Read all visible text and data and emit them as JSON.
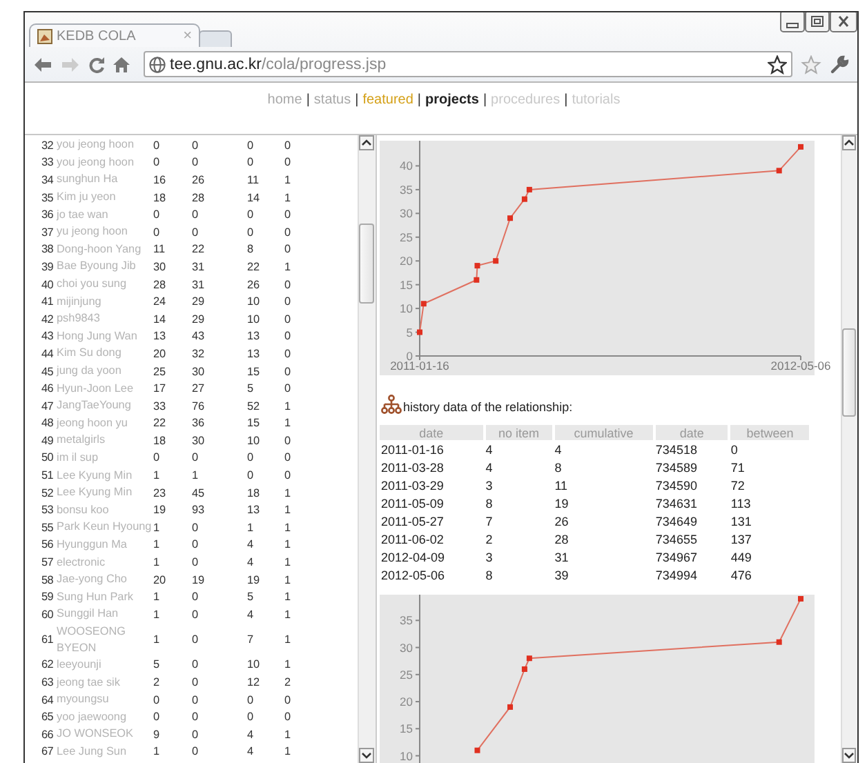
{
  "window": {
    "tab": {
      "title": "KEDB COLA",
      "close": "×",
      "selected": true
    },
    "address": {
      "host": "tee.gnu.ac.kr",
      "path": "/cola/progress.jsp"
    }
  },
  "nav": [
    {
      "label": "home",
      "kind": "muted",
      "separator": "|"
    },
    {
      "label": "status",
      "kind": "muted",
      "separator": "|"
    },
    {
      "label": "featured",
      "kind": "highlight",
      "separator": "|"
    },
    {
      "label": "projects",
      "kind": "current",
      "separator": "|"
    },
    {
      "label": "procedures",
      "kind": "faint",
      "separator": "|"
    },
    {
      "label": "tutorials",
      "kind": "faint"
    }
  ],
  "members": [
    {
      "no": "32",
      "name": "you jeong hoon",
      "values": [
        "0",
        "0",
        "0",
        "0"
      ]
    },
    {
      "no": "33",
      "name": "you jeong hoon",
      "values": [
        "0",
        "0",
        "0",
        "0"
      ]
    },
    {
      "no": "34",
      "name": "sunghun Ha",
      "values": [
        "16",
        "26",
        "11",
        "1"
      ]
    },
    {
      "no": "35",
      "name": "Kim ju yeon",
      "values": [
        "18",
        "28",
        "14",
        "1"
      ]
    },
    {
      "no": "36",
      "name": "jo tae wan",
      "values": [
        "0",
        "0",
        "0",
        "0"
      ]
    },
    {
      "no": "37",
      "name": "yu jeong hoon",
      "values": [
        "0",
        "0",
        "0",
        "0"
      ]
    },
    {
      "no": "38",
      "name": "Dong-hoon Yang",
      "values": [
        "11",
        "22",
        "8",
        "0"
      ]
    },
    {
      "no": "39",
      "name": "Bae Byoung Jib",
      "values": [
        "30",
        "31",
        "22",
        "1"
      ]
    },
    {
      "no": "40",
      "name": "choi you sung",
      "values": [
        "28",
        "31",
        "26",
        "0"
      ]
    },
    {
      "no": "41",
      "name": "mijinjung",
      "values": [
        "24",
        "29",
        "10",
        "0"
      ]
    },
    {
      "no": "42",
      "name": "psh9843",
      "values": [
        "14",
        "29",
        "10",
        "0"
      ]
    },
    {
      "no": "43",
      "name": "Hong Jung Wan",
      "values": [
        "13",
        "43",
        "13",
        "0"
      ]
    },
    {
      "no": "44",
      "name": "Kim Su dong",
      "values": [
        "20",
        "32",
        "13",
        "0"
      ]
    },
    {
      "no": "45",
      "name": "jung da yoon",
      "values": [
        "25",
        "30",
        "15",
        "0"
      ]
    },
    {
      "no": "46",
      "name": "Hyun-Joon Lee",
      "values": [
        "17",
        "27",
        "5",
        "0"
      ]
    },
    {
      "no": "47",
      "name": "JangTaeYoung",
      "values": [
        "33",
        "76",
        "52",
        "1"
      ]
    },
    {
      "no": "48",
      "name": "jeong hoon yu",
      "values": [
        "22",
        "36",
        "15",
        "1"
      ]
    },
    {
      "no": "49",
      "name": "metalgirls",
      "values": [
        "18",
        "30",
        "10",
        "0"
      ]
    },
    {
      "no": "50",
      "name": "im il sup",
      "values": [
        "0",
        "0",
        "0",
        "0"
      ]
    },
    {
      "no": "51",
      "name": "Lee Kyung Min",
      "values": [
        "1",
        "1",
        "0",
        "0"
      ]
    },
    {
      "no": "52",
      "name": "Lee Kyung Min",
      "values": [
        "23",
        "45",
        "18",
        "1"
      ]
    },
    {
      "no": "53",
      "name": "bonsu koo",
      "values": [
        "19",
        "93",
        "13",
        "1"
      ]
    },
    {
      "no": "55",
      "name": "Park Keun Hyoung",
      "values": [
        "1",
        "0",
        "1",
        "1"
      ]
    },
    {
      "no": "56",
      "name": "Hyunggun Ma",
      "values": [
        "1",
        "0",
        "4",
        "1"
      ]
    },
    {
      "no": "57",
      "name": "electronic",
      "values": [
        "1",
        "0",
        "4",
        "1"
      ]
    },
    {
      "no": "58",
      "name": "Jae-yong Cho",
      "values": [
        "20",
        "19",
        "19",
        "1"
      ]
    },
    {
      "no": "59",
      "name": "Sung Hun Park",
      "values": [
        "1",
        "0",
        "5",
        "1"
      ]
    },
    {
      "no": "60",
      "name": "Sunggil Han",
      "values": [
        "1",
        "0",
        "4",
        "1"
      ]
    },
    {
      "no": "61",
      "name": "WOOSEONG BYEON",
      "values": [
        "1",
        "0",
        "7",
        "1"
      ]
    },
    {
      "no": "62",
      "name": "leeyounji",
      "values": [
        "5",
        "0",
        "10",
        "1"
      ]
    },
    {
      "no": "63",
      "name": "jeong tae sik",
      "values": [
        "2",
        "0",
        "12",
        "2"
      ]
    },
    {
      "no": "64",
      "name": "myoungsu",
      "values": [
        "0",
        "0",
        "0",
        "0"
      ]
    },
    {
      "no": "65",
      "name": "yoo jaewoong",
      "values": [
        "0",
        "0",
        "0",
        "0"
      ]
    },
    {
      "no": "66",
      "name": "JO WONSEOK",
      "values": [
        "9",
        "0",
        "4",
        "1"
      ]
    },
    {
      "no": "67",
      "name": "Lee Jung Sun",
      "values": [
        "1",
        "0",
        "4",
        "1"
      ]
    }
  ],
  "relationship": {
    "chart_1": {
      "chart_data": {
        "type": "line",
        "x": [
          "2011-01-16",
          "2011-01-21",
          "2011-03-28",
          "2011-03-29",
          "2011-04-21",
          "2011-05-09",
          "2011-05-27",
          "2011-06-02",
          "2012-04-09",
          "2012-05-06"
        ],
        "series": [
          {
            "color": "#e03020",
            "marker": "square",
            "values": [
              5,
              11,
              16,
              19,
              20,
              29,
              33,
              35,
              39,
              44
            ]
          }
        ],
        "xlim": [
          "2011-01-16",
          "2012-05-06"
        ],
        "ylim": [
          0,
          45
        ],
        "yticks": [
          0,
          5,
          10,
          15,
          20,
          25,
          30,
          35,
          40
        ],
        "xticks": [
          {
            "value": "2011-01-16",
            "label": "2011-01-16"
          },
          {
            "value": "2012-05-06",
            "label": "2012-05-06"
          }
        ]
      }
    },
    "heading": "history data of the relationship:",
    "table": {
      "columns": [
        "date",
        "no item",
        "cumulative",
        "date",
        "between"
      ],
      "rows": [
        [
          "2011-01-16",
          "4",
          "4",
          "734518",
          "0"
        ],
        [
          "2011-03-28",
          "4",
          "8",
          "734589",
          "71"
        ],
        [
          "2011-03-29",
          "3",
          "11",
          "734590",
          "72"
        ],
        [
          "2011-05-09",
          "8",
          "19",
          "734631",
          "113"
        ],
        [
          "2011-05-27",
          "7",
          "26",
          "734649",
          "131"
        ],
        [
          "2011-06-02",
          "2",
          "28",
          "734655",
          "137"
        ],
        [
          "2012-04-09",
          "3",
          "31",
          "734967",
          "449"
        ],
        [
          "2012-05-06",
          "8",
          "39",
          "734994",
          "476"
        ]
      ]
    },
    "chart_2": {
      "chart_data": {
        "type": "line",
        "x": [
          "2011-03-29",
          "2011-05-09",
          "2011-05-27",
          "2011-06-02",
          "2012-04-09",
          "2012-05-06"
        ],
        "series": [
          {
            "color": "#e03020",
            "marker": "square",
            "values": [
              11,
              19,
              26,
              28,
              31,
              39
            ]
          }
        ],
        "xlim": [
          "2011-01-16",
          "2012-05-06"
        ],
        "ylim": [
          0,
          39.5
        ],
        "yticks": [
          10,
          15,
          20,
          25,
          30,
          35
        ]
      }
    }
  }
}
